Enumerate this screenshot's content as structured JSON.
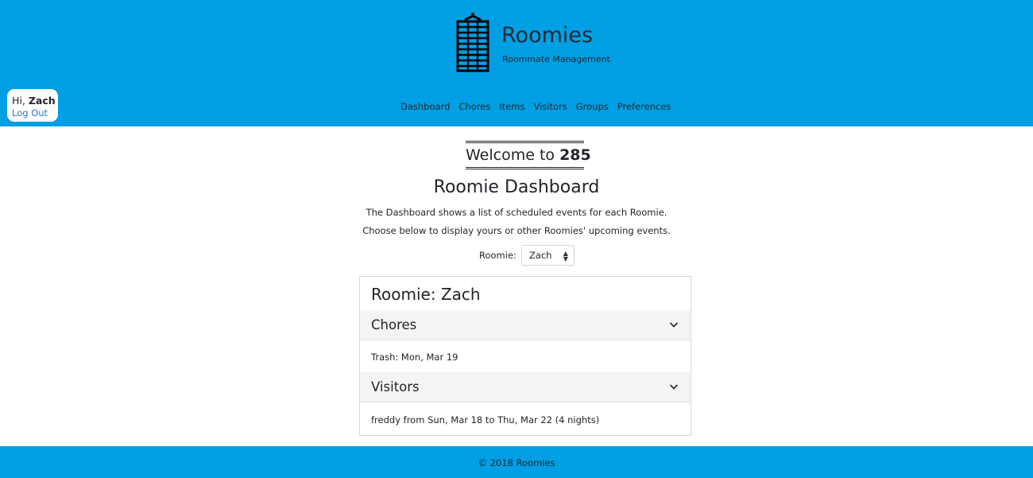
{
  "header": {
    "brand": {
      "title": "Roomies",
      "subtitle": "Roommate Management",
      "logo_icon": "building-icon"
    },
    "user": {
      "greeting_prefix": "Hi, ",
      "name": "Zach",
      "logout_label": "Log Out"
    },
    "nav": [
      {
        "label": "Dashboard"
      },
      {
        "label": "Chores"
      },
      {
        "label": "Items"
      },
      {
        "label": "Visitors"
      },
      {
        "label": "Groups"
      },
      {
        "label": "Preferences"
      }
    ],
    "background_color": "#009fe3"
  },
  "main": {
    "welcome_prefix": "Welcome to",
    "welcome_group": "285",
    "title": "Roomie Dashboard",
    "description_line1": "The Dashboard shows a list of scheduled events for each Roomie.",
    "description_line2": "Choose below to display yours or other Roomies' upcoming events.",
    "roomie_select": {
      "label": "Roomie:",
      "value": "Zach"
    },
    "card": {
      "title": "Roomie: Zach",
      "sections": [
        {
          "label": "Chores",
          "items": [
            "Trash: Mon, Mar 19"
          ]
        },
        {
          "label": "Visitors",
          "items": [
            "freddy from Sun, Mar 18 to Thu, Mar 22 (4 nights)"
          ]
        }
      ]
    }
  },
  "footer": {
    "text": "© 2018 Roomies"
  }
}
